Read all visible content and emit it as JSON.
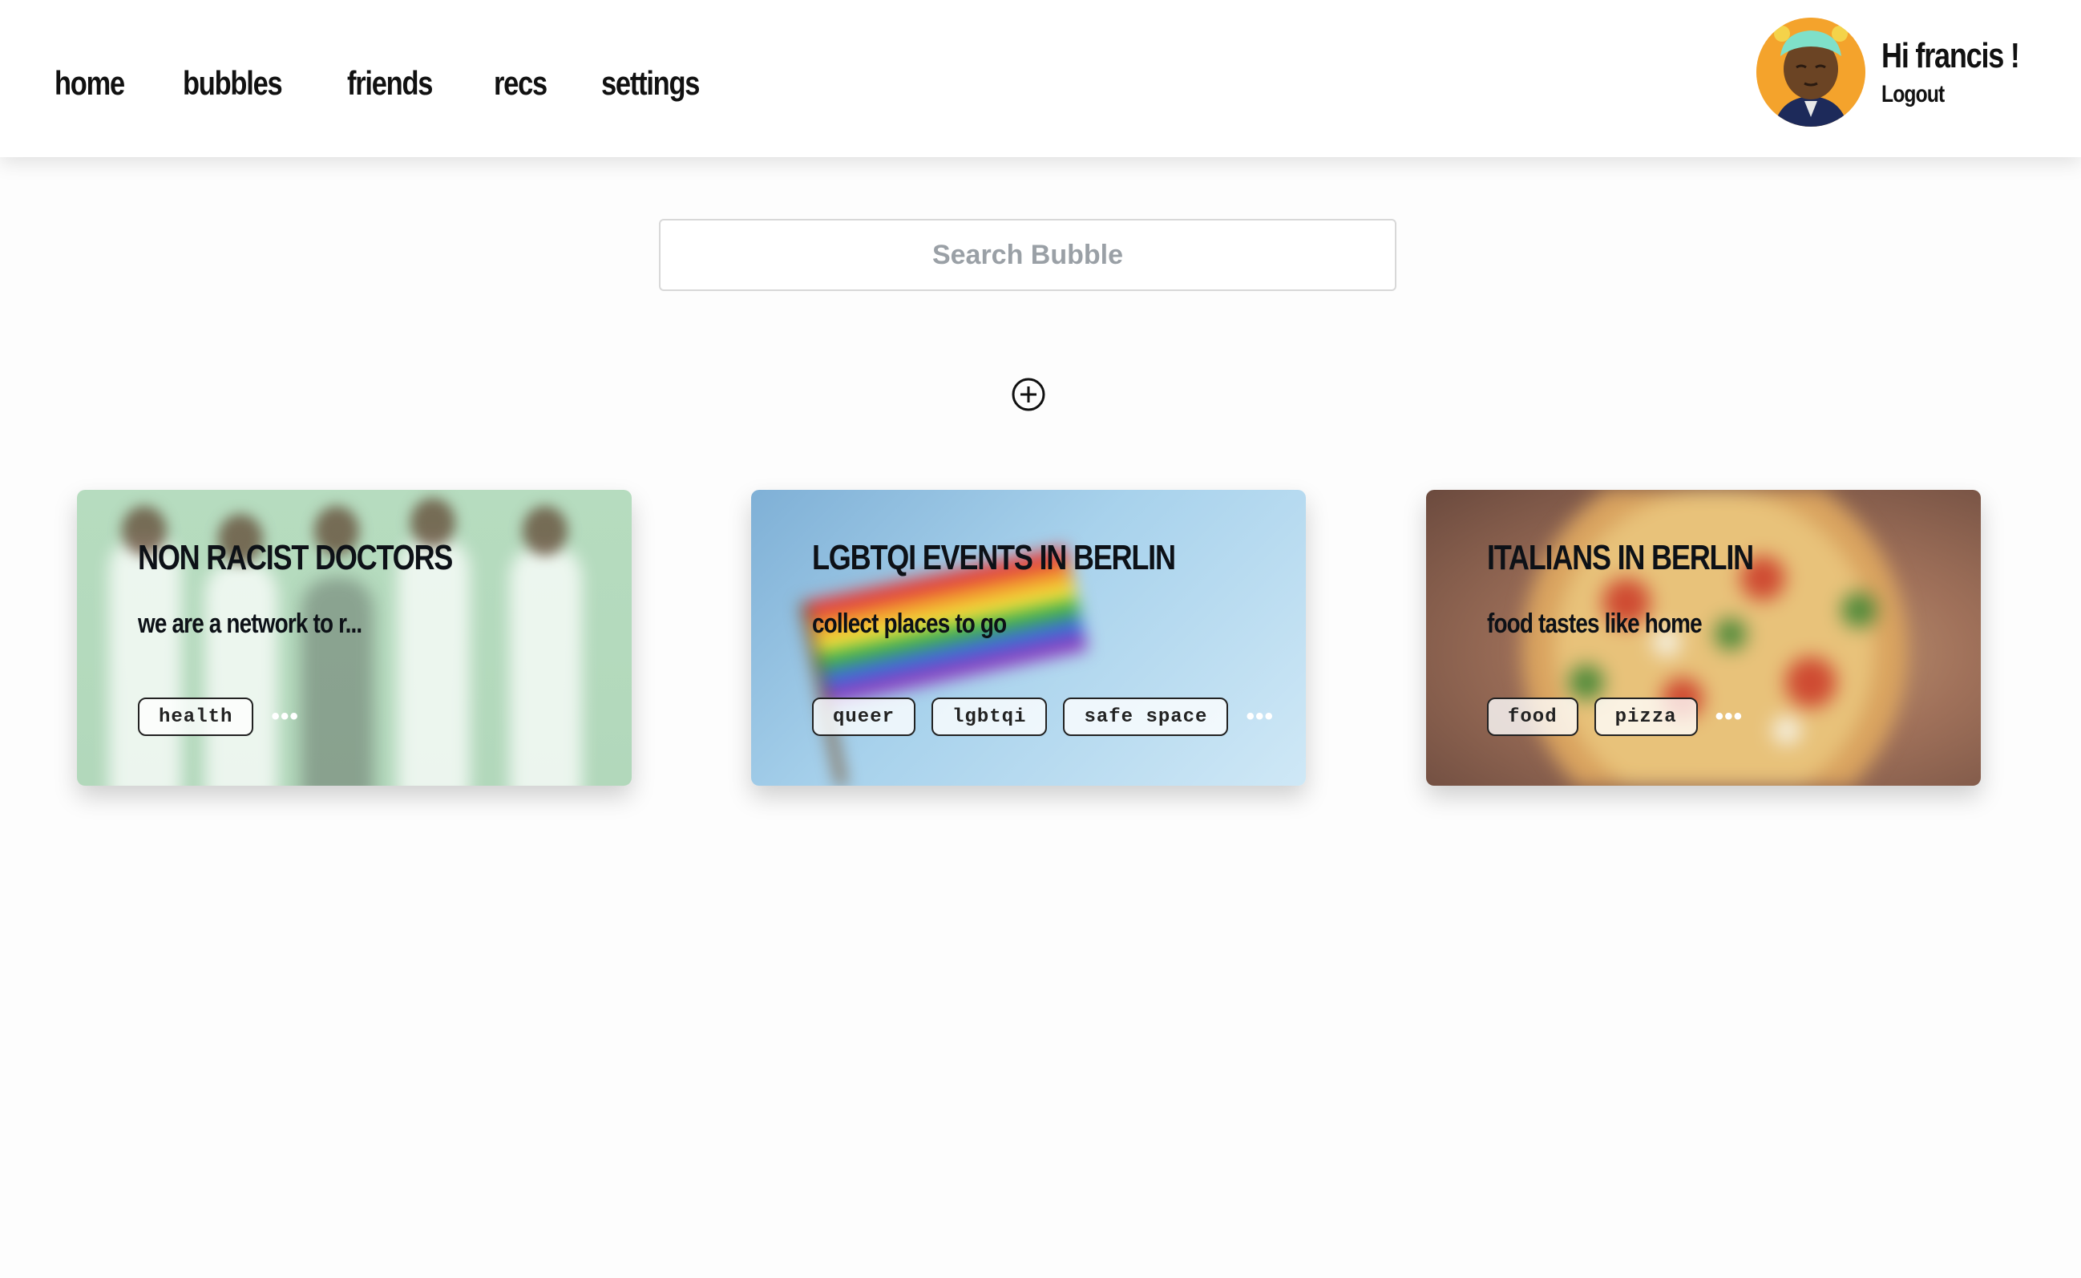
{
  "nav": {
    "items": [
      "home",
      "bubbles",
      "friends",
      "recs",
      "settings"
    ]
  },
  "user": {
    "greeting": "Hi francis !",
    "logout_label": "Logout"
  },
  "search": {
    "placeholder": "Search Bubble"
  },
  "add_button": {
    "icon": "plus-circle-icon"
  },
  "bubbles": [
    {
      "title": "NON RACIST DOCTORS",
      "description": "we are a network to r...",
      "tags": [
        "health"
      ],
      "more": "•••"
    },
    {
      "title": "LGBTQI EVENTS IN BERLIN",
      "description": "collect places to go",
      "tags": [
        "queer",
        "lgbtqi",
        "safe space"
      ],
      "more": "•••"
    },
    {
      "title": "ITALIANS IN BERLIN",
      "description": "food tastes like home",
      "tags": [
        "food",
        "pizza"
      ],
      "more": "•••"
    }
  ],
  "colors": {
    "avatar_bg": "#f4a32c",
    "doctors_bg": "#b6dcbf",
    "lgbt_bg": "#a8d2ec",
    "pizza_bg": "#a0715a"
  }
}
